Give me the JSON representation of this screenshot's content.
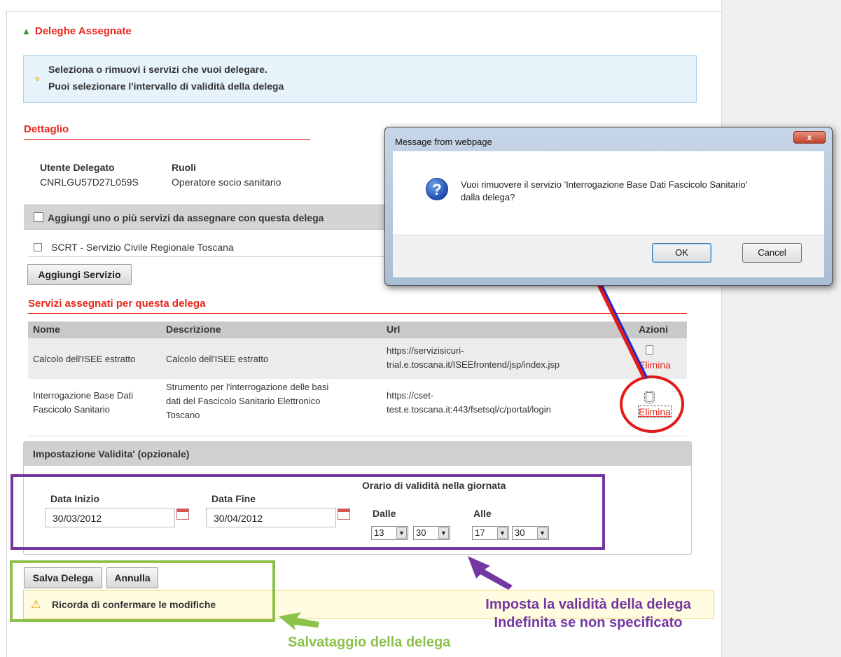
{
  "section_link": "Deleghe Assegnate",
  "info": {
    "line1": "Seleziona o rimuovi i servizi che vuoi delegare.",
    "line2": "Puoi selezionare l'intervallo di validità della delega"
  },
  "detail": {
    "title": "Dettaglio",
    "user_label": "Utente Delegato",
    "user_value": "CNRLGU57D27L059S",
    "roles_label": "Ruoli",
    "roles_value": "Operatore socio sanitario"
  },
  "add_services": {
    "header": "Aggiungi uno o più servizi da assegnare con questa delega",
    "option": "SCRT - Servizio Civile Regionale Toscana",
    "button": "Aggiungi Servizio"
  },
  "assigned": {
    "title": "Servizi assegnati per questa delega",
    "columns": [
      "Nome",
      "Descrizione",
      "Url",
      "Azioni"
    ],
    "rows": [
      {
        "nome": [
          "Calcolo dell'ISEE estratto"
        ],
        "descrizione": [
          "Calcolo dell'ISEE estratto"
        ],
        "url": [
          "https://servizisicuri-",
          "trial.e.toscana.it/ISEEfrontend/jsp/index.jsp"
        ],
        "action": "Elimina"
      },
      {
        "nome": [
          "Interrogazione Base Dati",
          "Fascicolo Sanitario"
        ],
        "descrizione": [
          "Strumento per l'interrogazione delle basi",
          "dati del Fascicolo Sanitario Elettronico",
          "Toscano"
        ],
        "url": [
          "https://cset-",
          "test.e.toscana.it:443/fsetsql/c/portal/login"
        ],
        "action": "Elimina"
      }
    ]
  },
  "validity": {
    "header": "Impostazione Validita' (opzionale)",
    "start_label": "Data Inizio",
    "start_value": "30/03/2012",
    "end_label": "Data Fine",
    "end_value": "30/04/2012",
    "daily_title": "Orario di validità nella giornata",
    "from_label": "Dalle",
    "from_hour": "13",
    "from_min": "30",
    "to_label": "Alle",
    "to_hour": "17",
    "to_min": "30"
  },
  "actions": {
    "save": "Salva Delega",
    "cancel": "Annulla",
    "warning": "Ricorda di confermare le modifiche"
  },
  "dialog": {
    "title": "Message from webpage",
    "close": "x",
    "message_line1": "Vuoi rimuovere il servizio 'Interrogazione Base Dati Fascicolo Sanitario'",
    "message_line2": "dalla delega?",
    "ok": "OK",
    "cancel": "Cancel"
  },
  "annotations": {
    "validity_line1": "Imposta la validità della delega",
    "validity_line2": "Indefinita se non specificato",
    "save_note": "Salvataggio della delega",
    "colors": {
      "purple": "#7437a1",
      "green": "#8cc14a",
      "red": "#e31b1b"
    }
  }
}
